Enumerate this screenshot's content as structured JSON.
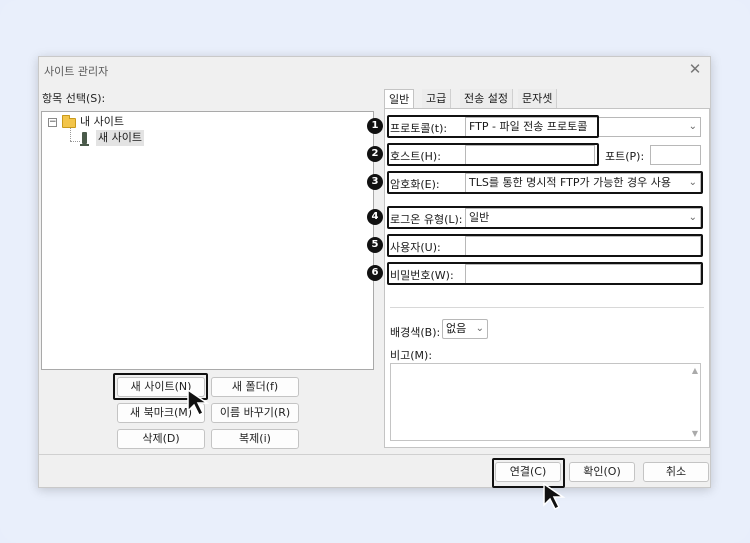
{
  "dialog": {
    "title": "사이트 관리자"
  },
  "left": {
    "section_label": "항목 선택(S):",
    "tree": {
      "root_label": "내 사이트",
      "child_label": "새 사이트"
    },
    "buttons": {
      "new_site": "새 사이트(N)",
      "new_folder": "새 폴더(f)",
      "new_bookmark": "새 북마크(M)",
      "rename": "이름 바꾸기(R)",
      "delete": "삭제(D)",
      "duplicate": "복제(i)"
    }
  },
  "tabs": [
    {
      "label": "일반",
      "active": true
    },
    {
      "label": "고급",
      "active": false
    },
    {
      "label": "전송 설정",
      "active": false
    },
    {
      "label": "문자셋",
      "active": false
    }
  ],
  "form": {
    "protocol": {
      "badge": "1",
      "label": "프로토콜(t):",
      "value": "FTP - 파일 전송 프로토콜"
    },
    "host": {
      "badge": "2",
      "label": "호스트(H):",
      "value": ""
    },
    "port": {
      "label": "포트(P):",
      "value": ""
    },
    "encryption": {
      "badge": "3",
      "label": "암호화(E):",
      "value": "TLS를 통한 명시적 FTP가 가능한 경우 사용"
    },
    "logon_type": {
      "badge": "4",
      "label": "로그온 유형(L):",
      "value": "일반"
    },
    "user": {
      "badge": "5",
      "label": "사용자(U):",
      "value": ""
    },
    "password": {
      "badge": "6",
      "label": "비밀번호(W):",
      "value": ""
    },
    "background_color": {
      "label": "배경색(B):",
      "value": "없음"
    },
    "notes": {
      "label": "비고(M):"
    }
  },
  "footer": {
    "connect": "연결(C)",
    "ok": "확인(O)",
    "cancel": "취소"
  },
  "icons": {
    "close": "close-icon",
    "chevron": "chevron-down-icon",
    "folder": "folder-icon",
    "site": "computer-icon",
    "cursor": "mouse-pointer-icon"
  }
}
